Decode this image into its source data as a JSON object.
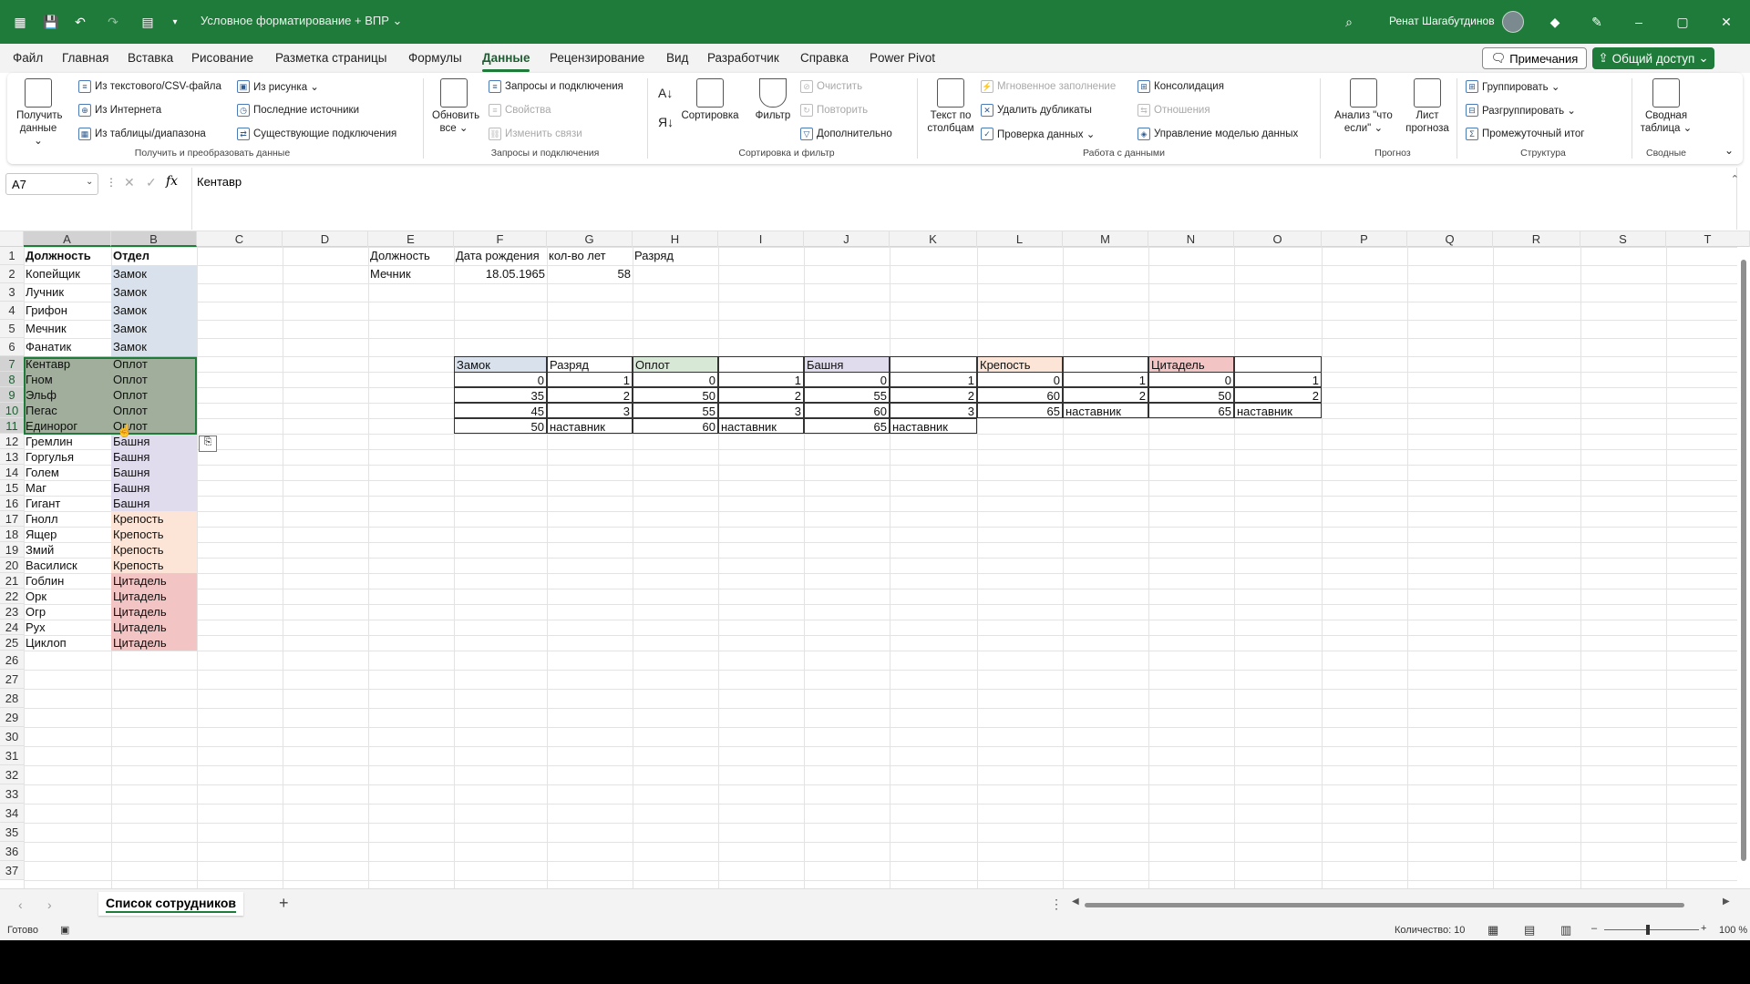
{
  "titlebar": {
    "doc_title": "Условное форматирование + ВПР ⌄",
    "user_name": "Ренат Шагабутдинов",
    "minimize": "–",
    "restore": "▢",
    "close": "✕",
    "icons": [
      "excel-logo-icon",
      "save-icon",
      "undo-icon",
      "redo-icon",
      "form-icon",
      "customize-icon",
      "search-icon",
      "diamond-icon",
      "pen-icon"
    ]
  },
  "menu": {
    "items": [
      "Файл",
      "Главная",
      "Вставка",
      "Рисование",
      "Разметка страницы",
      "Формулы",
      "Данные",
      "Рецензирование",
      "Вид",
      "Разработчик",
      "Справка",
      "Power Pivot"
    ],
    "active": "Данные",
    "notes_btn": "Примечания",
    "share_btn": "Общий доступ"
  },
  "ribbon": {
    "get_data": "Получить данные ⌄",
    "from_text_csv": "Из текстового/CSV-файла",
    "from_web": "Из Интернета",
    "from_table": "Из таблицы/диапазона",
    "from_picture": "Из рисунка ⌄",
    "recent_sources": "Последние источники",
    "existing_connections": "Существующие подключения",
    "group_get_transform": "Получить и преобразовать данные",
    "refresh_all": "Обновить все ⌄",
    "queries_connections": "Запросы и подключения",
    "properties": "Свойства",
    "edit_links": "Изменить связи",
    "group_queries": "Запросы и подключения",
    "sort": "Сортировка",
    "filter": "Фильтр",
    "clear": "Очистить",
    "reapply": "Повторить",
    "advanced": "Дополнительно",
    "group_sort_filter": "Сортировка и фильтр",
    "text_to_columns": "Текст по столбцам",
    "flash_fill": "Мгновенное заполнение",
    "remove_duplicates": "Удалить дубликаты",
    "data_validation": "Проверка данных ⌄",
    "consolidate": "Консолидация",
    "relationships": "Отношения",
    "data_model": "Управление моделью данных",
    "group_data_tools": "Работа с данными",
    "what_if": "Анализ \"что если\" ⌄",
    "forecast_sheet": "Лист прогноза",
    "group_forecast": "Прогноз",
    "group_btn": "Группировать ⌄",
    "ungroup_btn": "Разгруппировать ⌄",
    "subtotal": "Промежуточный итог",
    "group_outline": "Структура",
    "pivot": "Сводная таблица ⌄",
    "group_pivot": "Сводные"
  },
  "formula_bar": {
    "name_box": "A7",
    "fx": "fx",
    "value": "Кентавр"
  },
  "columns": [
    "A",
    "B",
    "C",
    "D",
    "E",
    "F",
    "G",
    "H",
    "I",
    "J",
    "K",
    "L",
    "M",
    "N",
    "O",
    "P",
    "Q",
    "R",
    "S",
    "T"
  ],
  "rows": [
    "1",
    "2",
    "3",
    "4",
    "5",
    "6",
    "7",
    "8",
    "9",
    "10",
    "11",
    "12",
    "13",
    "14",
    "15",
    "16",
    "17",
    "18",
    "19",
    "20",
    "21",
    "22",
    "23",
    "24",
    "25",
    "26",
    "27",
    "28",
    "29",
    "30",
    "31",
    "32",
    "33",
    "34",
    "35",
    "36",
    "37"
  ],
  "colors": {
    "zamok": "#d9e2ec",
    "oplot": "#d8e8d6",
    "oplot_sel": "#aebda9",
    "bashnya": "#e1dbee",
    "krepost": "#fce4d6",
    "citadel": "#f2c4c4",
    "accent": "#1e7b39"
  },
  "employees": [
    {
      "pos": "Должность",
      "dept": "Отдел"
    },
    {
      "pos": "Копейщик",
      "dept": "Замок"
    },
    {
      "pos": "Лучник",
      "dept": "Замок"
    },
    {
      "pos": "Грифон",
      "dept": "Замок"
    },
    {
      "pos": "Мечник",
      "dept": "Замок"
    },
    {
      "pos": "Фанатик",
      "dept": "Замок"
    },
    {
      "pos": "Кентавр",
      "dept": "Оплот"
    },
    {
      "pos": "Гном",
      "dept": "Оплот"
    },
    {
      "pos": "Эльф",
      "dept": "Оплот"
    },
    {
      "pos": "Пегас",
      "dept": "Оплот"
    },
    {
      "pos": "Единорог",
      "dept": "Оплот"
    },
    {
      "pos": "Гремлин",
      "dept": "Башня"
    },
    {
      "pos": "Горгулья",
      "dept": "Башня"
    },
    {
      "pos": "Голем",
      "dept": "Башня"
    },
    {
      "pos": "Маг",
      "dept": "Башня"
    },
    {
      "pos": "Гигант",
      "dept": "Башня"
    },
    {
      "pos": "Гнолл",
      "dept": "Крепость"
    },
    {
      "pos": "Ящер",
      "dept": "Крепость"
    },
    {
      "pos": "Змий",
      "dept": "Крепость"
    },
    {
      "pos": "Василиск",
      "dept": "Крепость"
    },
    {
      "pos": "Гоблин",
      "dept": "Цитадель"
    },
    {
      "pos": "Орк",
      "dept": "Цитадель"
    },
    {
      "pos": "Огр",
      "dept": "Цитадель"
    },
    {
      "pos": "Рух",
      "dept": "Цитадель"
    },
    {
      "pos": "Циклоп",
      "dept": "Цитадель"
    }
  ],
  "lookup": {
    "headers": [
      "Должность",
      "Дата рождения",
      "кол-во лет",
      "Разряд"
    ],
    "position": "Мечник",
    "birth_date": "18.05.1965",
    "age": "58",
    "rank": ""
  },
  "rank_tables": {
    "headers": [
      "Замок",
      "Разряд",
      "Оплот",
      "",
      "Башня",
      "",
      "Крепость",
      "",
      "Цитадель",
      ""
    ],
    "rows": [
      [
        "0",
        "1",
        "0",
        "1",
        "0",
        "1",
        "0",
        "1",
        "0",
        "1"
      ],
      [
        "35",
        "2",
        "50",
        "2",
        "55",
        "2",
        "60",
        "2",
        "50",
        "2"
      ],
      [
        "45",
        "3",
        "55",
        "3",
        "60",
        "3",
        "65",
        "наставник",
        "65",
        "наставник"
      ],
      [
        "50",
        "наставник",
        "60",
        "наставник",
        "65",
        "наставник",
        "",
        "",
        "",
        ""
      ]
    ]
  },
  "sheet_tabs": {
    "active": "Список сотрудников",
    "add": "+"
  },
  "status": {
    "ready": "Готово",
    "count": "Количество: 10",
    "zoom": "100 %"
  }
}
